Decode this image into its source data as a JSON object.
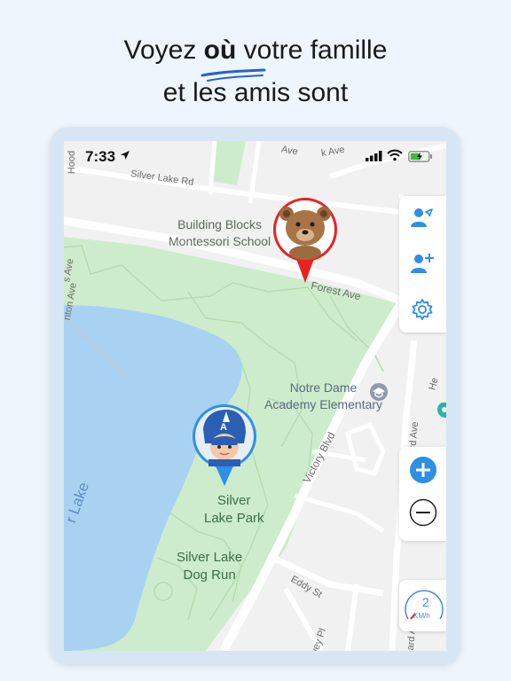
{
  "headline": {
    "line1_before": "Voyez ",
    "line1_bold": "où",
    "line1_after": " votre famille",
    "line2": "et les amis sont"
  },
  "status_bar": {
    "time": "7:33",
    "icons": [
      "location-arrow-icon",
      "signal-bars-icon",
      "wifi-icon",
      "battery-charging-icon"
    ]
  },
  "map": {
    "roads": {
      "silver_lake_rd": "Silver Lake Rd",
      "forest_ave": "Forest Ave",
      "ave_top": "Ave",
      "hood_top": "Hood",
      "victory_blvd": "Victory Blvd",
      "eddy_st": "Eddy St",
      "howard_ave": "Howard Ave",
      "he_edge": "He",
      "ard_ave": "ard Ave",
      "rvey_pl": "rvey Pl",
      "s_ave_left": "s Ave",
      "nton_ave_left": "nton Ave",
      "k_ave": "k Ave",
      "lake_edge": "r Lake"
    },
    "pois": {
      "building_blocks": "Building Blocks\nMontessori School",
      "notre_dame": "Notre Dame\nAcademy Elementary",
      "silver_lake_park": "Silver\nLake Park",
      "dog_run": "Silver Lake\nDog Run"
    },
    "colors": {
      "water": "#aad3f2",
      "park": "#c9ebc7",
      "road": "#ffffff",
      "land": "#f2f2f2",
      "pin_red": "#e8231f",
      "pin_blue": "#2f8ee6"
    },
    "markers": [
      {
        "name": "teddy-bear",
        "pin_color": "red"
      },
      {
        "name": "captain-america-kid",
        "pin_color": "blue"
      }
    ]
  },
  "controls": {
    "share_location_icon": "person-location-icon",
    "add_person_icon": "person-add-icon",
    "settings_icon": "gear-icon",
    "zoom_in_icon": "plus-icon",
    "zoom_out_icon": "minus-icon",
    "speed_value": "2",
    "speed_unit": "KM/h"
  }
}
